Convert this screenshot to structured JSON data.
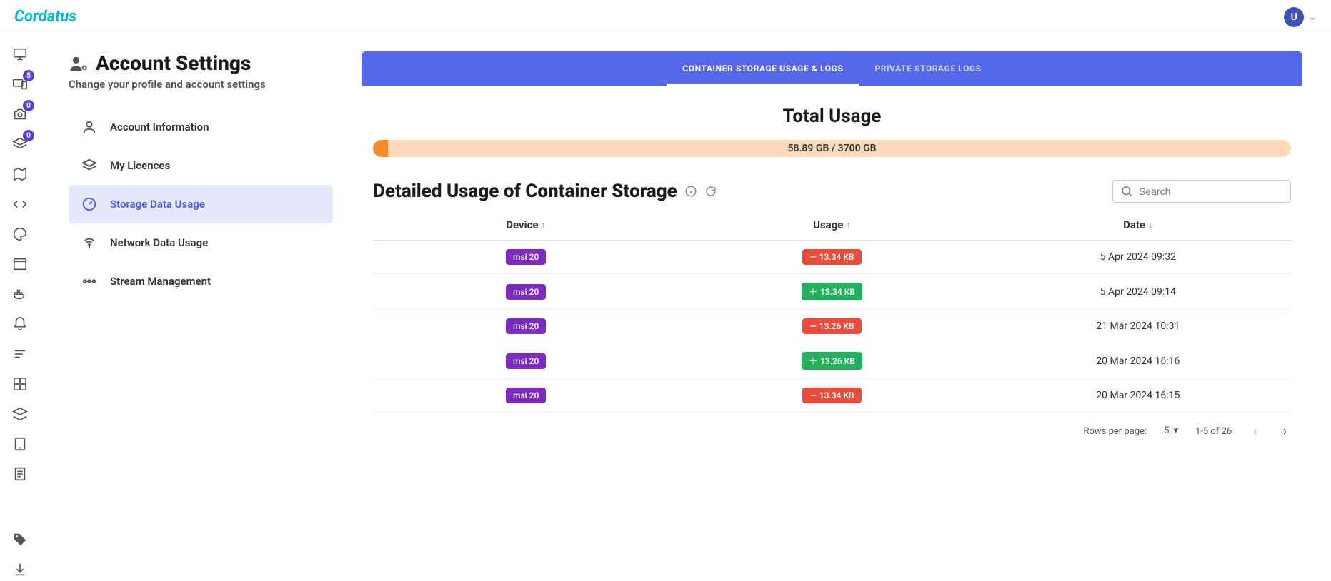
{
  "brand": "Cordatus",
  "user": {
    "initial": "U"
  },
  "sidebar_badges": {
    "devices": "5",
    "camera": "0",
    "layers": "0"
  },
  "page": {
    "title": "Account Settings",
    "subtitle": "Change your profile and account settings"
  },
  "settings_nav": {
    "account": "Account Information",
    "licences": "My Licences",
    "storage": "Storage Data Usage",
    "network": "Network Data Usage",
    "stream": "Stream Management"
  },
  "tabs": {
    "container": "CONTAINER STORAGE USAGE & LOGS",
    "private": "PRIVATE STORAGE LOGS"
  },
  "total_usage": {
    "title": "Total Usage",
    "label": "58.89 GB / 3700 GB",
    "percent": 1.6
  },
  "detail": {
    "title": "Detailed Usage of Container Storage",
    "search_placeholder": "Search",
    "columns": {
      "device": "Device",
      "usage": "Usage",
      "date": "Date"
    },
    "rows": [
      {
        "device": "msi 20",
        "usage": "13.34 KB",
        "delta": "minus",
        "date": "5 Apr 2024 09:32"
      },
      {
        "device": "msi 20",
        "usage": "13.34 KB",
        "delta": "plus",
        "date": "5 Apr 2024 09:14"
      },
      {
        "device": "msi 20",
        "usage": "13.26 KB",
        "delta": "minus",
        "date": "21 Mar 2024 10:31"
      },
      {
        "device": "msi 20",
        "usage": "13.26 KB",
        "delta": "plus",
        "date": "20 Mar 2024 16:16"
      },
      {
        "device": "msi 20",
        "usage": "13.34 KB",
        "delta": "minus",
        "date": "20 Mar 2024 16:15"
      }
    ],
    "footer": {
      "rows_per_page_label": "Rows per page:",
      "rows_per_page_value": "5",
      "range": "1-5 of 26"
    }
  }
}
